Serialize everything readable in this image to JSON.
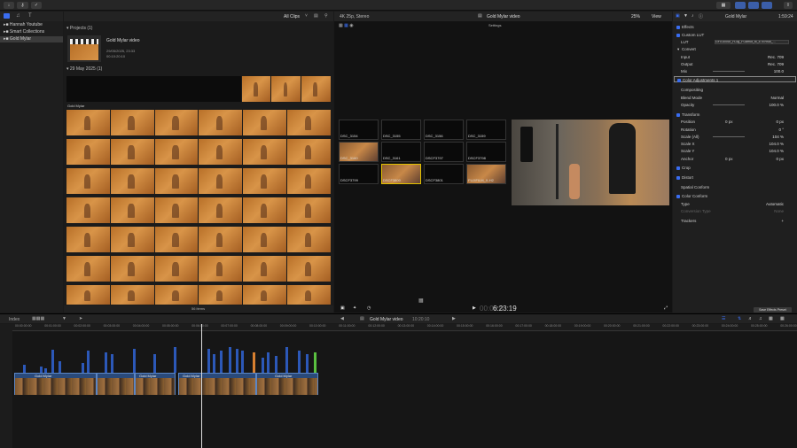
{
  "toolbar": {
    "import_icon": "download-icon",
    "key_icon": "key-icon",
    "check_icon": "checkmark-icon",
    "share_icon": "share-icon"
  },
  "library": {
    "items": [
      {
        "label": "Hannah Youtube"
      },
      {
        "label": "Smart Collections"
      },
      {
        "label": "Gold Mylar"
      }
    ]
  },
  "browser": {
    "filter": "All Clips",
    "projects_label": "Projects",
    "projects_count": "(1)",
    "project_name": "Gold Mylar video",
    "project_date": "29/05/2025, 23:33",
    "project_duration": "00:10:20:10",
    "date_group": "29 May 2025",
    "date_count": "(1)",
    "clip_label": "Gold Mylar",
    "items_count": "56 items"
  },
  "viewer": {
    "format": "4K 25p, Stereo",
    "title": "Gold Mylar video",
    "zoom": "25%",
    "view_label": "View",
    "settings_label": "Settings",
    "timecode": "6:23:19",
    "timecode_prefix": "00:00:0",
    "thumbs": [
      {
        "label": "DSC_3154"
      },
      {
        "label": "DSC_3155"
      },
      {
        "label": "DSC_3156"
      },
      {
        "label": "DSC_3159"
      },
      {
        "label": "DSC_3160"
      },
      {
        "label": "DSC_3161"
      },
      {
        "label": "DSCF3797"
      },
      {
        "label": "DSCF3798"
      },
      {
        "label": "DSCF3799"
      },
      {
        "label": "DSCF3800"
      },
      {
        "label": "DSCF3801"
      },
      {
        "label": "FUJIFILM_X-H2"
      }
    ]
  },
  "inspector": {
    "clip_name": "Gold Mylar",
    "duration": "1:59:24",
    "effects": "Effects",
    "custom_lut": "Custom LUT",
    "lut_label": "LUT",
    "lut_value": "GFX100SII_FLog_FGamut_to_ETERNA_...",
    "convert": "Convert",
    "input_label": "Input",
    "input_value": "Rec. 709",
    "output_label": "Output",
    "output_value": "Rec. 709",
    "mix_label": "Mix",
    "mix_value": "100.0",
    "color_adj": "Color Adjustments 1",
    "compositing": "Compositing",
    "blend_label": "Blend Mode",
    "blend_value": "Normal",
    "opacity_label": "Opacity",
    "opacity_value": "100.0 %",
    "transform": "Transform",
    "position_label": "Position",
    "pos_x": "0 px",
    "pos_y": "0 px",
    "rotation_label": "Rotation",
    "rotation_value": "0 °",
    "scale_all_label": "Scale (All)",
    "scale_all_value": "104 %",
    "scale_x_label": "Scale X",
    "scale_x_value": "104.0 %",
    "scale_y_label": "Scale Y",
    "scale_y_value": "104.0 %",
    "anchor_label": "Anchor",
    "anc_x": "0 px",
    "anc_y": "0 px",
    "crop": "Crop",
    "distort": "Distort",
    "spatial": "Spatial Conform",
    "color_conform": "Color Conform",
    "type_label": "Type",
    "type_value": "Automatic",
    "conv_label": "Conversion Type",
    "conv_value": "None",
    "trackers": "Trackers",
    "save_preset": "Save Effects Preset"
  },
  "timeline": {
    "index": "Index",
    "title": "Gold Mylar video",
    "duration": "10:20:10",
    "clip_label": "Gold Mylar",
    "ticks": [
      "00:00:00:00",
      "00:01:00:00",
      "00:02:00:00",
      "00:03:00:00",
      "00:04:00:00",
      "00:05:00:00",
      "00:06:00:00",
      "00:07:00:00",
      "00:08:00:00",
      "00:09:00:00",
      "00:10:00:00",
      "00:11:00:00",
      "00:12:00:00",
      "00:13:00:00",
      "00:14:00:00",
      "00:15:00:00",
      "00:16:00:00",
      "00:17:00:00",
      "00:18:00:00",
      "00:19:00:00",
      "00:20:00:00",
      "00:21:00:00",
      "00:22:00:00",
      "00:23:00:00",
      "00:24:00:00",
      "00:25:00:00",
      "00:26:00:00"
    ]
  }
}
